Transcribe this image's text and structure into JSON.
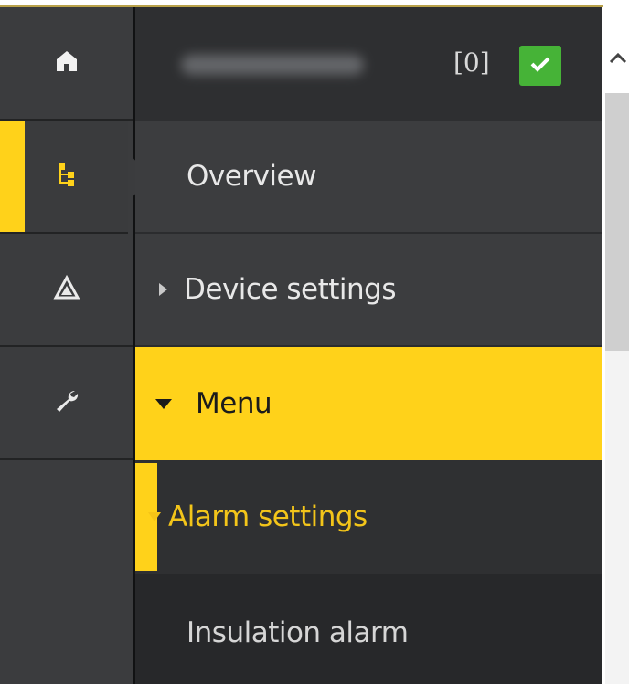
{
  "header": {
    "status_count": "[0]"
  },
  "rail": {
    "items": [
      {
        "icon": "home-icon"
      },
      {
        "icon": "tree-icon"
      },
      {
        "icon": "warning-triangle-icon"
      },
      {
        "icon": "wrench-icon"
      }
    ]
  },
  "nav": {
    "overview": "Overview",
    "device_settings": "Device settings",
    "menu": "Menu",
    "alarm_settings": "Alarm settings",
    "insulation_alarm": "Insulation alarm"
  },
  "colors": {
    "accent": "#ffd21a",
    "ok": "#46b337",
    "panel": "#3c3d3f"
  }
}
